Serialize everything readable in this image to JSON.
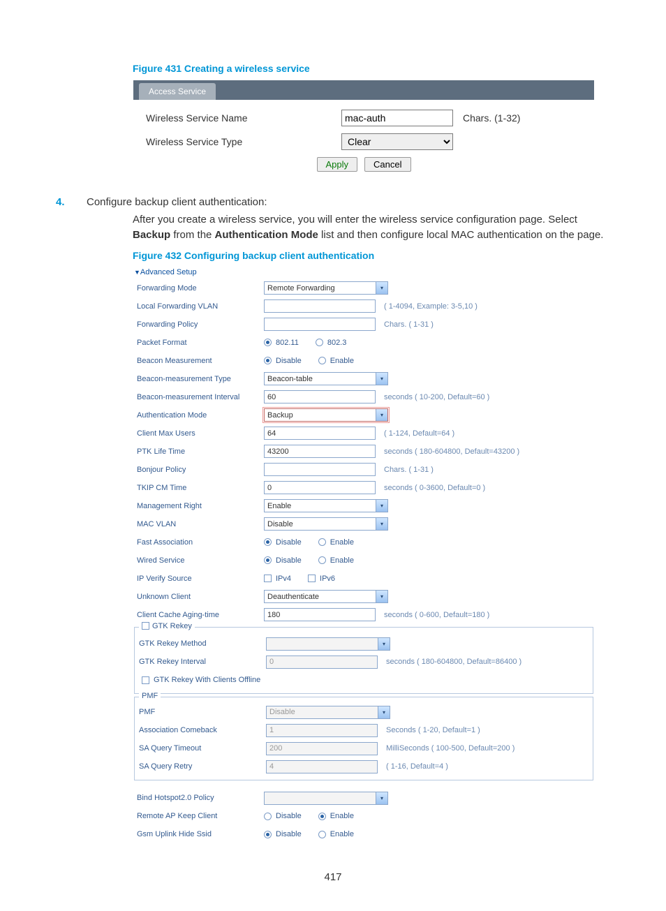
{
  "page_number": "417",
  "figure431": {
    "caption": "Figure 431 Creating a wireless service",
    "tab": "Access Service",
    "rows": {
      "name_label": "Wireless Service Name",
      "name_value": "mac-auth",
      "name_hint": "Chars. (1-32)",
      "type_label": "Wireless Service Type",
      "type_value": "Clear"
    },
    "buttons": {
      "apply": "Apply",
      "cancel": "Cancel"
    }
  },
  "step4": {
    "num": "4.",
    "title": "Configure backup client authentication:",
    "desc_before": "After you create a wireless service, you will enter the wireless service configuration page. Select ",
    "desc_bold1": "Backup",
    "desc_mid": " from the ",
    "desc_bold2": "Authentication Mode",
    "desc_after": " list and then configure local MAC authentication on the page."
  },
  "figure432": {
    "caption": "Figure 432 Configuring backup client authentication",
    "header": "Advanced Setup",
    "rows": {
      "fwd_mode": {
        "label": "Forwarding Mode",
        "value": "Remote Forwarding"
      },
      "local_vlan": {
        "label": "Local Forwarding VLAN",
        "value": "",
        "hint": "( 1-4094, Example: 3-5,10 )"
      },
      "fwd_policy": {
        "label": "Forwarding Policy",
        "value": "",
        "hint": "Chars. ( 1-31 )"
      },
      "pkt_fmt": {
        "label": "Packet Format",
        "opt1": "802.11",
        "opt2": "802.3"
      },
      "beacon_meas": {
        "label": "Beacon Measurement",
        "opt1": "Disable",
        "opt2": "Enable"
      },
      "beacon_type": {
        "label": "Beacon-measurement Type",
        "value": "Beacon-table"
      },
      "beacon_int": {
        "label": "Beacon-measurement Interval",
        "value": "60",
        "hint": "seconds ( 10-200, Default=60 )"
      },
      "auth_mode": {
        "label": "Authentication Mode",
        "value": "Backup"
      },
      "max_users": {
        "label": "Client Max Users",
        "value": "64",
        "hint": "( 1-124, Default=64 )"
      },
      "ptk_life": {
        "label": "PTK Life Time",
        "value": "43200",
        "hint": "seconds ( 180-604800, Default=43200 )"
      },
      "bonjour": {
        "label": "Bonjour Policy",
        "value": "",
        "hint": "Chars. ( 1-31 )"
      },
      "tkip": {
        "label": "TKIP CM Time",
        "value": "0",
        "hint": "seconds ( 0-3600, Default=0 )"
      },
      "mgmt_right": {
        "label": "Management Right",
        "value": "Enable"
      },
      "mac_vlan": {
        "label": "MAC VLAN",
        "value": "Disable"
      },
      "fast_assoc": {
        "label": "Fast Association",
        "opt1": "Disable",
        "opt2": "Enable"
      },
      "wired": {
        "label": "Wired Service",
        "opt1": "Disable",
        "opt2": "Enable"
      },
      "ip_verify": {
        "label": "IP Verify Source",
        "opt1": "IPv4",
        "opt2": "IPv6"
      },
      "unknown": {
        "label": "Unknown Client",
        "value": "Deauthenticate"
      },
      "cache_age": {
        "label": "Client Cache Aging-time",
        "value": "180",
        "hint": "seconds ( 0-600, Default=180 )"
      }
    },
    "gtk": {
      "legend": "GTK Rekey",
      "method": {
        "label": "GTK Rekey Method",
        "value": ""
      },
      "interval": {
        "label": "GTK Rekey Interval",
        "value": "0",
        "hint": "seconds ( 180-604800, Default=86400 )"
      },
      "offline": "GTK Rekey With Clients Offline"
    },
    "pmf": {
      "legend": "PMF",
      "pmf": {
        "label": "PMF",
        "value": "Disable"
      },
      "assoc": {
        "label": "Association Comeback",
        "value": "1",
        "hint": "Seconds ( 1-20, Default=1 )"
      },
      "timeout": {
        "label": "SA Query Timeout",
        "value": "200",
        "hint": "MilliSeconds ( 100-500, Default=200 )"
      },
      "retry": {
        "label": "SA Query Retry",
        "value": "4",
        "hint": "( 1-16, Default=4 )"
      }
    },
    "bottom": {
      "hotspot": {
        "label": "Bind Hotspot2.0 Policy",
        "value": ""
      },
      "keep_client": {
        "label": "Remote AP Keep Client",
        "opt1": "Disable",
        "opt2": "Enable"
      },
      "hide_ssid": {
        "label": "Gsm Uplink Hide Ssid",
        "opt1": "Disable",
        "opt2": "Enable"
      }
    }
  }
}
